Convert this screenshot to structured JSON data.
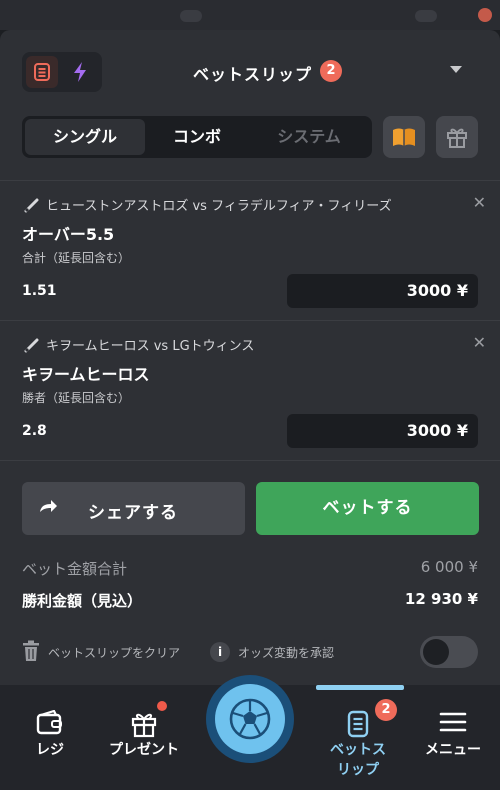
{
  "header": {
    "title": "ベットスリップ",
    "count": "2",
    "icons": [
      "betslip-list-icon",
      "lightning-icon",
      "chevron-down-icon"
    ]
  },
  "tabs": [
    {
      "label": "シングル",
      "active": true
    },
    {
      "label": "コンボ",
      "active": false
    },
    {
      "label": "システム",
      "active": false
    }
  ],
  "toolbar": {
    "icons": [
      "book-icon",
      "gift-icon"
    ]
  },
  "bets": [
    {
      "match": "ヒューストンアストロズ vs フィラデルフィア・フィリーズ",
      "pick": "オーバー5.5",
      "market": "合計（延長回含む）",
      "odds": "1.51",
      "stake": "3000 ¥"
    },
    {
      "match": "キヲームヒーロス vs LGトウィンス",
      "pick": "キヲームヒーロス",
      "market": "勝者（延長回含む）",
      "odds": "2.8",
      "stake": "3000 ¥"
    }
  ],
  "actions": {
    "share_label": "シェアする",
    "place_label": "ベットする"
  },
  "summary": {
    "total_label": "ベット金額合計",
    "total_value": "6 000 ¥",
    "win_label": "勝利金額（見込）",
    "win_value": "12 930 ¥"
  },
  "options": {
    "clear_label": "ベットスリップをクリア",
    "info_glyph": "i",
    "accept_label": "オッズ変動を承認",
    "accept_toggle_on": false
  },
  "nav": {
    "reji": "レジ",
    "present": "プレゼント",
    "betslip": "ベットス\nリップ",
    "betslip_badge": "2",
    "menu": "メニュー"
  },
  "colors": {
    "accent": "#8fd0f2",
    "place_button": "#3fa55a",
    "badge": "#ef6b5a",
    "background": "#2e3035"
  }
}
